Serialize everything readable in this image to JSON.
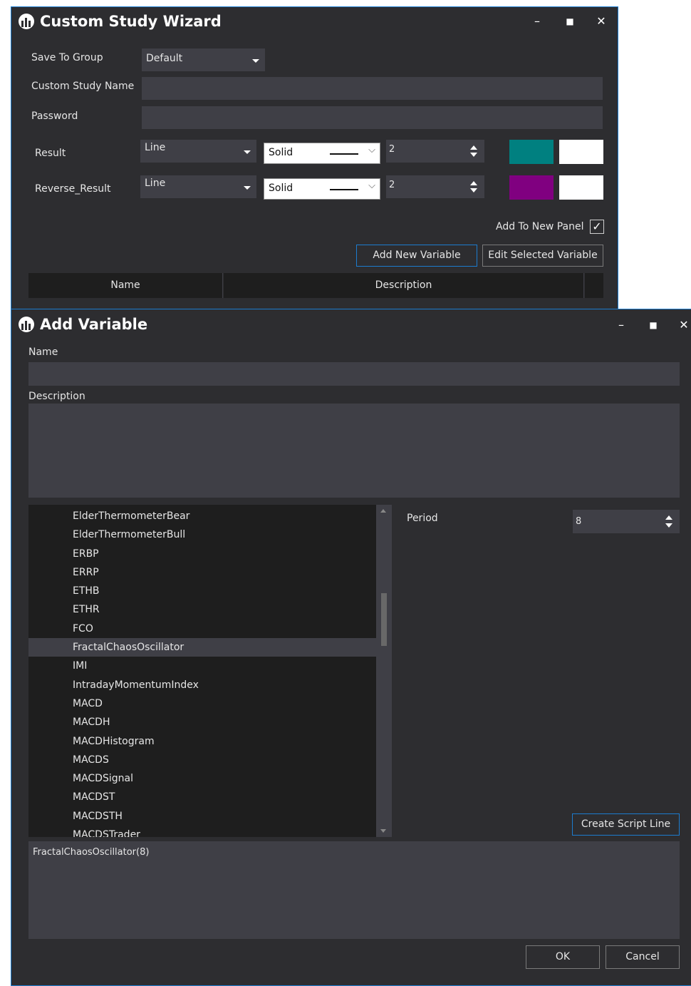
{
  "wizard": {
    "title": "Custom Study Wizard",
    "controls": {
      "minimize": "–",
      "maximize": "■",
      "close": "✕"
    },
    "save_to_group": {
      "label": "Save To Group",
      "value": "Default"
    },
    "custom_study_name": {
      "label": "Custom Study Name",
      "value": ""
    },
    "password": {
      "label": "Password",
      "value": ""
    },
    "result": {
      "label": "Result",
      "type": "Line",
      "style": "Solid",
      "width": "2",
      "color": "#008080",
      "color2": "#ffffff"
    },
    "reverse_result": {
      "label": "Reverse_Result",
      "type": "Line",
      "style": "Solid",
      "width": "2",
      "color": "#800080",
      "color2": "#ffffff"
    },
    "add_to_new_panel": {
      "label": "Add To New Panel",
      "checked": true,
      "check": "✓"
    },
    "add_new_variable": "Add New Variable",
    "edit_selected_variable": "Edit Selected Variable",
    "table_headers": {
      "name": "Name",
      "description": "Description"
    }
  },
  "add_variable": {
    "title": "Add Variable",
    "controls": {
      "minimize": "–",
      "maximize": "■",
      "close": "✕"
    },
    "name_label": "Name",
    "name_value": "",
    "description_label": "Description",
    "description_value": "",
    "indicators": [
      "ElderThermometerBear",
      "ElderThermometerBull",
      "ERBP",
      "ERRP",
      "ETHB",
      "ETHR",
      "FCO",
      "FractalChaosOscillator",
      "IMI",
      "IntradayMomentumIndex",
      "MACD",
      "MACDH",
      "MACDHistogram",
      "MACDS",
      "MACDSignal",
      "MACDST",
      "MACDSTH",
      "MACDSTrader"
    ],
    "selected_indicator": "FractalChaosOscillator",
    "period": {
      "label": "Period",
      "value": "8"
    },
    "create_script_line": "Create Script Line",
    "script_text": "FractalChaosOscillator(8)",
    "ok": "OK",
    "cancel": "Cancel"
  }
}
